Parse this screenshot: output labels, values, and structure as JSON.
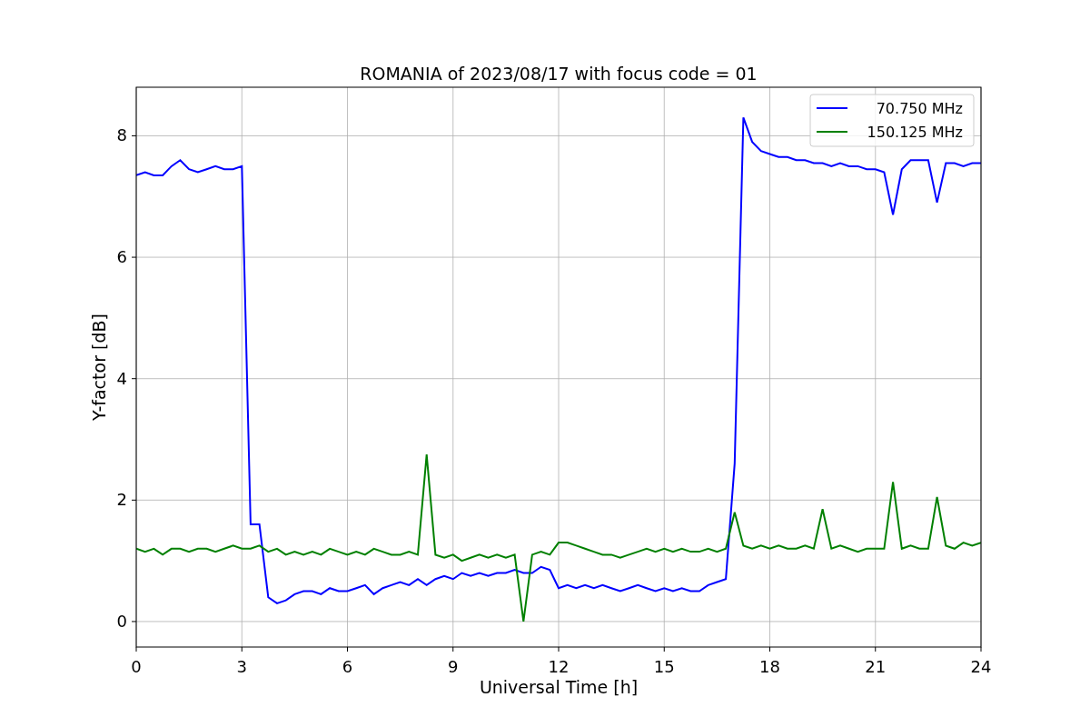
{
  "chart_data": {
    "type": "line",
    "title": "ROMANIA of 2023/08/17 with focus code = 01",
    "xlabel": "Universal Time [h]",
    "ylabel": "Y-factor [dB]",
    "x": [
      0,
      0.25,
      0.5,
      0.75,
      1,
      1.25,
      1.5,
      1.75,
      2,
      2.25,
      2.5,
      2.75,
      3,
      3.25,
      3.5,
      3.75,
      4,
      4.25,
      4.5,
      4.75,
      5,
      5.25,
      5.5,
      5.75,
      6,
      6.25,
      6.5,
      6.75,
      7,
      7.25,
      7.5,
      7.75,
      8,
      8.25,
      8.5,
      8.75,
      9,
      9.25,
      9.5,
      9.75,
      10,
      10.25,
      10.5,
      10.75,
      11,
      11.25,
      11.5,
      11.75,
      12,
      12.25,
      12.5,
      12.75,
      13,
      13.25,
      13.5,
      13.75,
      14,
      14.25,
      14.5,
      14.75,
      15,
      15.25,
      15.5,
      15.75,
      16,
      16.25,
      16.5,
      16.75,
      17,
      17.25,
      17.5,
      17.75,
      18,
      18.25,
      18.5,
      18.75,
      19,
      19.25,
      19.5,
      19.75,
      20,
      20.25,
      20.5,
      20.75,
      21,
      21.25,
      21.5,
      21.75,
      22,
      22.25,
      22.5,
      22.75,
      23,
      23.25,
      23.5,
      23.75,
      24
    ],
    "series": [
      {
        "name": "70.750 MHz",
        "color": "#0000ff",
        "values": [
          7.35,
          7.4,
          7.35,
          7.35,
          7.5,
          7.6,
          7.45,
          7.4,
          7.45,
          7.5,
          7.45,
          7.45,
          7.5,
          1.6,
          1.6,
          0.4,
          0.3,
          0.35,
          0.45,
          0.5,
          0.5,
          0.45,
          0.55,
          0.5,
          0.5,
          0.55,
          0.6,
          0.45,
          0.55,
          0.6,
          0.65,
          0.6,
          0.7,
          0.6,
          0.7,
          0.75,
          0.7,
          0.8,
          0.75,
          0.8,
          0.75,
          0.8,
          0.8,
          0.85,
          0.8,
          0.8,
          0.9,
          0.85,
          0.55,
          0.6,
          0.55,
          0.6,
          0.55,
          0.6,
          0.55,
          0.5,
          0.55,
          0.6,
          0.55,
          0.5,
          0.55,
          0.5,
          0.55,
          0.5,
          0.5,
          0.6,
          0.65,
          0.7,
          2.6,
          8.3,
          7.9,
          7.75,
          7.7,
          7.65,
          7.65,
          7.6,
          7.6,
          7.55,
          7.55,
          7.5,
          7.55,
          7.5,
          7.5,
          7.45,
          7.45,
          7.4,
          6.7,
          7.45,
          7.6,
          7.6,
          7.6,
          6.9,
          7.55,
          7.55,
          7.5,
          7.55,
          7.55
        ]
      },
      {
        "name": "150.125 MHz",
        "color": "#008000",
        "values": [
          1.2,
          1.15,
          1.2,
          1.1,
          1.2,
          1.2,
          1.15,
          1.2,
          1.2,
          1.15,
          1.2,
          1.25,
          1.2,
          1.2,
          1.25,
          1.15,
          1.2,
          1.1,
          1.15,
          1.1,
          1.15,
          1.1,
          1.2,
          1.15,
          1.1,
          1.15,
          1.1,
          1.2,
          1.15,
          1.1,
          1.1,
          1.15,
          1.1,
          2.75,
          1.1,
          1.05,
          1.1,
          1.0,
          1.05,
          1.1,
          1.05,
          1.1,
          1.05,
          1.1,
          0.0,
          1.1,
          1.15,
          1.1,
          1.3,
          1.3,
          1.25,
          1.2,
          1.15,
          1.1,
          1.1,
          1.05,
          1.1,
          1.15,
          1.2,
          1.15,
          1.2,
          1.15,
          1.2,
          1.15,
          1.15,
          1.2,
          1.15,
          1.2,
          1.8,
          1.25,
          1.2,
          1.25,
          1.2,
          1.25,
          1.2,
          1.2,
          1.25,
          1.2,
          1.85,
          1.2,
          1.25,
          1.2,
          1.15,
          1.2,
          1.2,
          1.2,
          2.3,
          1.2,
          1.25,
          1.2,
          1.2,
          2.05,
          1.25,
          1.2,
          1.3,
          1.25,
          1.3
        ]
      }
    ],
    "grid": true,
    "legend": "upper right",
    "xlim": [
      0,
      24
    ],
    "ylim": [
      -0.42,
      8.8
    ],
    "xticks": [
      0,
      3,
      6,
      9,
      12,
      15,
      18,
      21,
      24
    ],
    "yticks": [
      0,
      2,
      4,
      6,
      8
    ]
  }
}
